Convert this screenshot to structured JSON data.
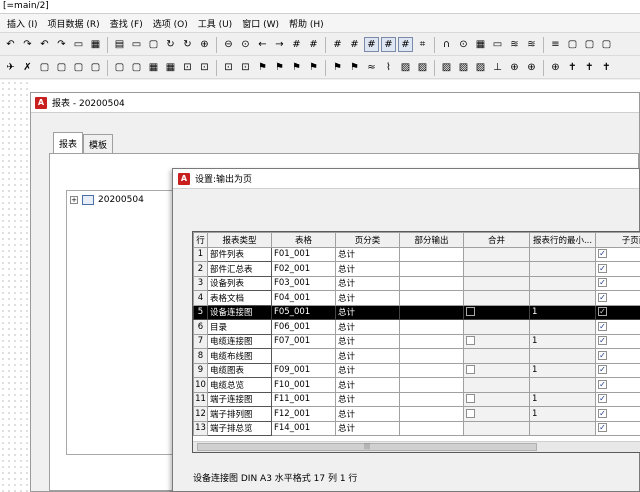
{
  "app": {
    "title": "[=main/2]"
  },
  "menu": [
    "插入 (I)",
    "项目数据 (R)",
    "查找 (F)",
    "选项 (O)",
    "工具 (U)",
    "窗口 (W)",
    "帮助 (H)"
  ],
  "toolbar1": [
    "↶",
    "↷",
    "↶",
    "↷",
    "▭",
    "▦",
    "▤",
    "▭",
    "▢",
    "↻",
    "↻",
    "⊕",
    "⊖",
    "⊙",
    "←",
    "→",
    "#",
    "#",
    "#",
    "#",
    "#",
    "#",
    "#",
    "⌗",
    "∩",
    "⊙",
    "▦",
    "▭",
    "≋",
    "≋",
    "≡",
    "▢",
    "▢",
    "▢"
  ],
  "toolbar2": [
    "✈",
    "✗",
    "▢",
    "▢",
    "▢",
    "▢",
    "▢",
    "▢",
    "▦",
    "▦",
    "⊡",
    "⊡",
    "⊡",
    "⊡",
    "⚑",
    "⚑",
    "⚑",
    "⚑",
    "⚑",
    "⚑",
    "≈",
    "⌇",
    "▨",
    "▨",
    "▨",
    "▨",
    "▨",
    "⊥",
    "⊕",
    "⊕",
    "⊕",
    "✝",
    "✝",
    "✝"
  ],
  "report_window": {
    "title": "报表 - 20200504",
    "tabs": [
      "报表",
      "模板"
    ],
    "tree_node": "20200504",
    "tree_expander": "+"
  },
  "dialog": {
    "title": "设置:输出为页",
    "columns": [
      "行",
      "报表类型",
      "表格",
      "页分类",
      "部分输出",
      "合并",
      "报表行的最小...",
      "子页面"
    ],
    "rows": [
      {
        "n": "1",
        "type": "部件列表",
        "form": "F01_001",
        "page": "总计",
        "merge": false,
        "min": "",
        "sub": true
      },
      {
        "n": "2",
        "type": "部件汇总表",
        "form": "F02_001",
        "page": "总计",
        "merge": false,
        "min": "",
        "sub": true
      },
      {
        "n": "3",
        "type": "设备列表",
        "form": "F03_001",
        "page": "总计",
        "merge": false,
        "min": "",
        "sub": true
      },
      {
        "n": "4",
        "type": "表格文档",
        "form": "F04_001",
        "page": "总计",
        "merge": false,
        "min": "",
        "sub": true
      },
      {
        "n": "5",
        "type": "设备连接图",
        "form": "F05_001",
        "page": "总计",
        "merge": true,
        "min": "1",
        "sub": true
      },
      {
        "n": "6",
        "type": "目录",
        "form": "F06_001",
        "page": "总计",
        "merge": false,
        "min": "",
        "sub": true
      },
      {
        "n": "7",
        "type": "电缆连接图",
        "form": "F07_001",
        "page": "总计",
        "merge": true,
        "min": "1",
        "sub": true
      },
      {
        "n": "8",
        "type": "电缆布线图",
        "form": "",
        "page": "总计",
        "merge": false,
        "min": "",
        "sub": true
      },
      {
        "n": "9",
        "type": "电缆图表",
        "form": "F09_001",
        "page": "总计",
        "merge": true,
        "min": "1",
        "sub": true
      },
      {
        "n": "10",
        "type": "电缆总览",
        "form": "F10_001",
        "page": "总计",
        "merge": false,
        "min": "",
        "sub": true
      },
      {
        "n": "11",
        "type": "端子连接图",
        "form": "F11_001",
        "page": "总计",
        "merge": true,
        "min": "1",
        "sub": true
      },
      {
        "n": "12",
        "type": "端子排列图",
        "form": "F12_001",
        "page": "总计",
        "merge": true,
        "min": "1",
        "sub": true
      },
      {
        "n": "13",
        "type": "端子排总览",
        "form": "F14_001",
        "page": "总计",
        "merge": false,
        "min": "",
        "sub": true
      }
    ],
    "selected_row": 5,
    "status": "设备连接图 DIN A3 水平格式 17 列 1 行",
    "scroll_grip": "|||"
  },
  "colors": {
    "app_red": "#c8201e",
    "selection": "#000000",
    "check": "#1e3c8c"
  }
}
